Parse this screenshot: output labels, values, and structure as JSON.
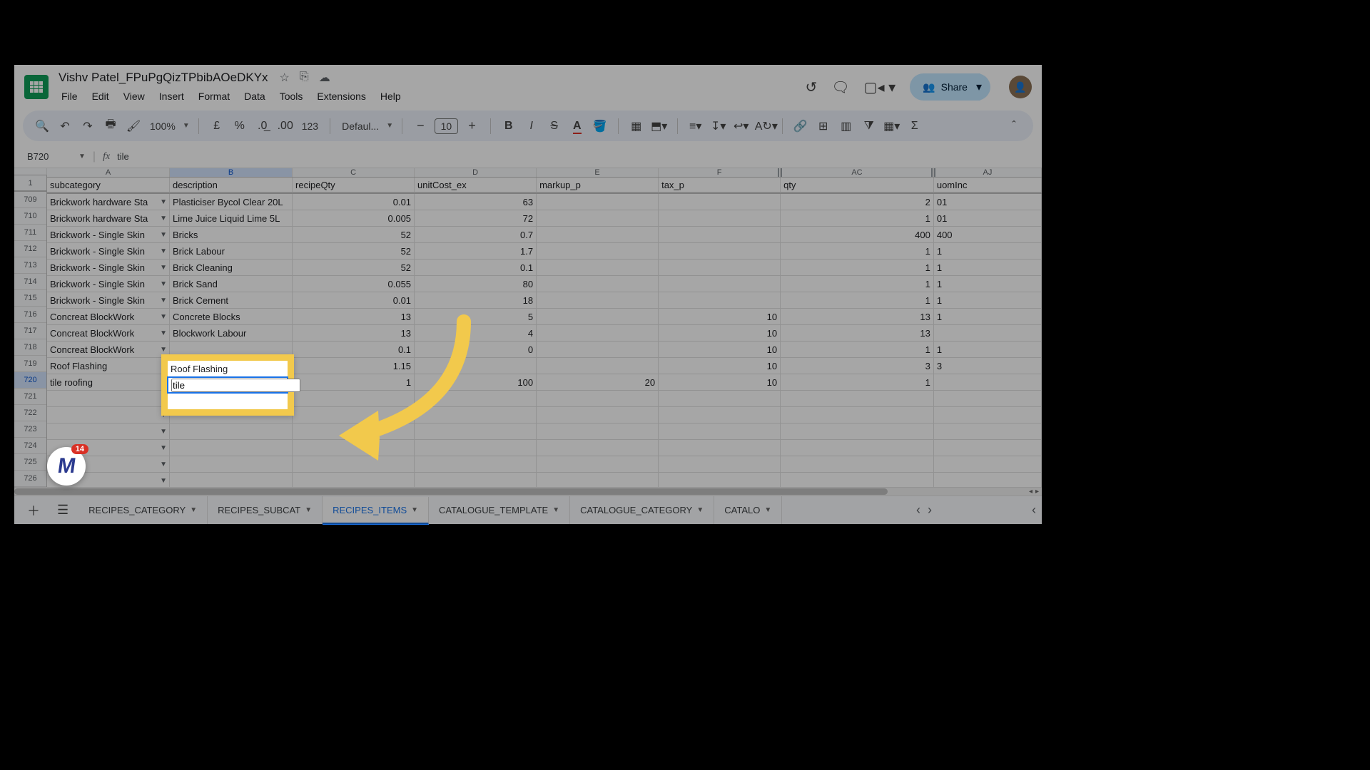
{
  "doc": {
    "title": "Vishv Patel_FPuPgQizTPbibAOeDKYx",
    "menus": [
      "File",
      "Edit",
      "View",
      "Insert",
      "Format",
      "Data",
      "Tools",
      "Extensions",
      "Help"
    ],
    "share_label": "Share"
  },
  "toolbar": {
    "zoom": "100%",
    "font_label": "Defaul...",
    "font_size": "10"
  },
  "fxbar": {
    "cell_ref": "B720",
    "formula": "tile"
  },
  "columns": [
    {
      "id": "A",
      "label": "A",
      "cls": "cw-A"
    },
    {
      "id": "B",
      "label": "B",
      "cls": "cw-B",
      "selected": true
    },
    {
      "id": "C",
      "label": "C",
      "cls": "cw-C"
    },
    {
      "id": "D",
      "label": "D",
      "cls": "cw-D"
    },
    {
      "id": "E",
      "label": "E",
      "cls": "cw-E"
    },
    {
      "id": "F",
      "label": "F",
      "cls": "cw-F",
      "break_after": true
    },
    {
      "id": "AC",
      "label": "AC",
      "cls": "cw-AC",
      "break_after": true
    },
    {
      "id": "AJ",
      "label": "AJ",
      "cls": "cw-AJ"
    }
  ],
  "header_row": {
    "num": "1",
    "cells": {
      "A": "subcategory",
      "B": "description",
      "C": "recipeQty",
      "D": "unitCost_ex",
      "E": "markup_p",
      "F": "tax_p",
      "AC": "qty",
      "AJ": "uomInc"
    }
  },
  "rows": [
    {
      "num": "709",
      "A": "Brickwork hardware Sta",
      "dd": true,
      "B": "Plasticiser Bycol Clear 20L",
      "C": "0.01",
      "D": "63",
      "AC": "2",
      "AJ": "01"
    },
    {
      "num": "710",
      "A": "Brickwork hardware Sta",
      "dd": true,
      "B": "Lime Juice Liquid Lime 5L",
      "C": "0.005",
      "D": "72",
      "AC": "1",
      "AJ": "01"
    },
    {
      "num": "711",
      "A": "Brickwork - Single Skin",
      "dd": true,
      "B": "Bricks",
      "C": "52",
      "D": "0.7",
      "AC": "400",
      "AJ": "400"
    },
    {
      "num": "712",
      "A": "Brickwork - Single Skin",
      "dd": true,
      "B": "Brick Labour",
      "C": "52",
      "D": "1.7",
      "AC": "1",
      "AJ": "1"
    },
    {
      "num": "713",
      "A": "Brickwork - Single Skin",
      "dd": true,
      "B": "Brick Cleaning",
      "C": "52",
      "D": "0.1",
      "AC": "1",
      "AJ": "1"
    },
    {
      "num": "714",
      "A": "Brickwork - Single Skin",
      "dd": true,
      "B": "Brick Sand",
      "C": "0.055",
      "D": "80",
      "AC": "1",
      "AJ": "1"
    },
    {
      "num": "715",
      "A": "Brickwork - Single Skin",
      "dd": true,
      "B": "Brick Cement",
      "C": "0.01",
      "D": "18",
      "AC": "1",
      "AJ": "1"
    },
    {
      "num": "716",
      "A": "Concreat BlockWork",
      "dd": true,
      "B": "Concrete Blocks",
      "C": "13",
      "D": "5",
      "F": "10",
      "AC": "13",
      "AJ": "1"
    },
    {
      "num": "717",
      "A": "Concreat BlockWork",
      "dd": true,
      "B": "Blockwork Labour",
      "C": "13",
      "D": "4",
      "F": "10",
      "AC": "13"
    },
    {
      "num": "718",
      "A": "Concreat BlockWork",
      "dd": true,
      "B": "",
      "C": "0.1",
      "D": "0",
      "F": "10",
      "AC": "1",
      "AJ": "1"
    },
    {
      "num": "719",
      "A": "Roof Flashing",
      "dd": false,
      "B": "",
      "C": "1.15",
      "F": "10",
      "AC": "3",
      "AJ": "3"
    },
    {
      "num": "720",
      "A": "tile roofing",
      "dd": false,
      "B": "",
      "C": "1",
      "D": "100",
      "E": "20",
      "F": "10",
      "AC": "1",
      "selected": true
    },
    {
      "num": "721",
      "dd": true
    },
    {
      "num": "722",
      "dd": true
    },
    {
      "num": "723",
      "dd": true
    },
    {
      "num": "724",
      "dd": true
    },
    {
      "num": "725",
      "dd": true
    },
    {
      "num": "726",
      "dd": true
    }
  ],
  "highlight": {
    "line1": "Roof Flashing",
    "line2_value": "tile"
  },
  "sheets": [
    {
      "label": "RECIPES_CATEGORY"
    },
    {
      "label": "RECIPES_SUBCAT"
    },
    {
      "label": "RECIPES_ITEMS",
      "active": true
    },
    {
      "label": "CATALOGUE_TEMPLATE"
    },
    {
      "label": "CATALOGUE_CATEGORY"
    },
    {
      "label": "CATALO"
    }
  ],
  "float_badge": "14"
}
